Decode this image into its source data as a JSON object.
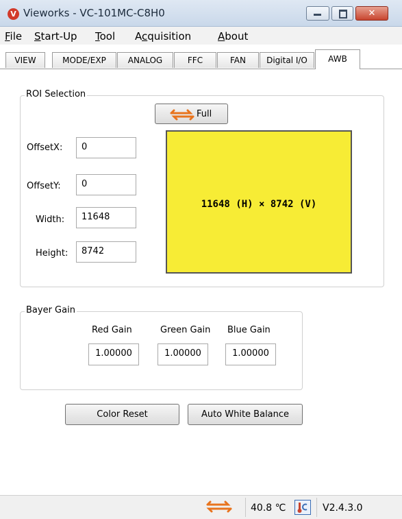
{
  "window": {
    "title": "Vieworks - VC-101MC-C8H0",
    "icon_letter": "V"
  },
  "menu": [
    {
      "label": "File",
      "u": "F",
      "rest": "ile"
    },
    {
      "label": "Start-Up",
      "u": "S",
      "rest": "tart-Up"
    },
    {
      "label": "Tool",
      "u": "T",
      "rest": "ool"
    },
    {
      "label": "Acquisition",
      "pre": "A",
      "u": "c",
      "rest": "quisition"
    },
    {
      "label": "About",
      "u": "A",
      "rest": "bout"
    }
  ],
  "tabs": [
    "VIEW",
    "MODE/EXP",
    "ANALOG",
    "FFC",
    "FAN",
    "Digital I/O",
    "AWB"
  ],
  "active_tab": "AWB",
  "roi": {
    "legend": "ROI Selection",
    "full_button": "Full",
    "offsetx_label": "OffsetX:",
    "offsetx_value": "0",
    "offsety_label": "OffsetY:",
    "offsety_value": "0",
    "width_label": "Width:",
    "width_value": "11648",
    "height_label": "Height:",
    "height_value": "8742",
    "preview_text": "11648 (H) × 8742 (V)",
    "preview_color": "#f7ec35"
  },
  "bayer": {
    "legend": "Bayer Gain",
    "red_label": "Red Gain",
    "red_value": "1.00000",
    "green_label": "Green Gain",
    "green_value": "1.00000",
    "blue_label": "Blue Gain",
    "blue_value": "1.00000"
  },
  "buttons": {
    "color_reset": "Color Reset",
    "auto_white_balance": "Auto White Balance"
  },
  "status": {
    "temperature": "40.8 ℃",
    "version": "V2.4.3.0"
  },
  "colors": {
    "accent_arrow": "#e8741e",
    "close_button": "#c8452f"
  }
}
